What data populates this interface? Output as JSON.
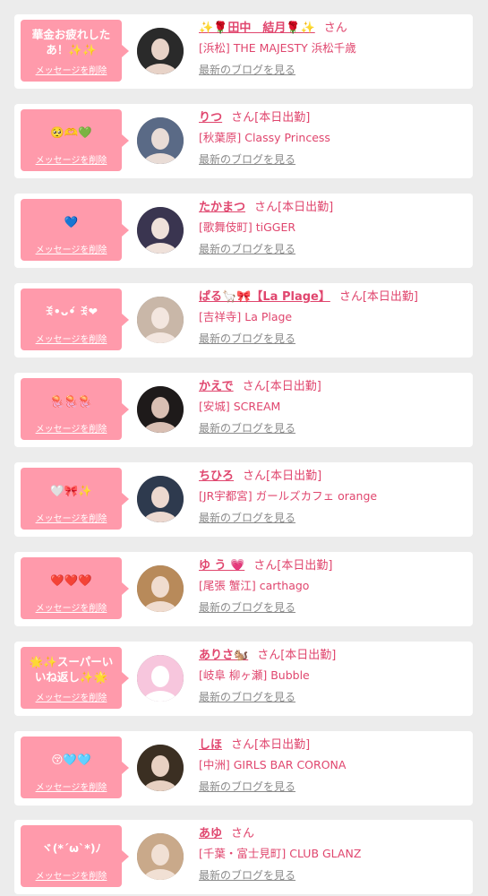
{
  "delete_label": "メッセージを削除",
  "blog_label": "最新のブログを見る",
  "honorific": "さん",
  "items": [
    {
      "message": "華金お疲れした あ！✨✨",
      "name": "✨🌹田中　結月🌹✨",
      "status": "",
      "shop": "[浜松] THE MAJESTY 浜松千歳",
      "avatar_colors": [
        "#2a2a2a",
        "#e8d3c8"
      ]
    },
    {
      "message": "🥺🫶💚",
      "name": "りつ",
      "status": "[本日出勤]",
      "shop": "[秋葉原] Classy Princess",
      "avatar_colors": [
        "#5a6a86",
        "#e9dcd6"
      ]
    },
    {
      "message": "💙",
      "name": "たかまつ",
      "status": "[本日出勤]",
      "shop": "[歌舞伎町] tiGGER",
      "avatar_colors": [
        "#3a3550",
        "#efe1da"
      ]
    },
    {
      "message": "ꉂ•ᴗ•́ ꉂ❤",
      "name": "ぱる🦙🎀【La Plage】",
      "status": "[本日出勤]",
      "shop": "[吉祥寺] La Plage",
      "avatar_colors": [
        "#c9b7a8",
        "#f3e6df"
      ]
    },
    {
      "message": "🪼🪼🪼",
      "name": "かえで",
      "status": "[本日出勤]",
      "shop": "[安城] SCREAM",
      "avatar_colors": [
        "#1e1a1a",
        "#d9bfb3"
      ]
    },
    {
      "message": "🤍🎀✨",
      "name": "ちひろ",
      "status": "[本日出勤]",
      "shop": "[JR宇都宮] ガールズカフェ orange",
      "avatar_colors": [
        "#2e3a4e",
        "#ecd8cf"
      ]
    },
    {
      "message": "❤️❤️❤️",
      "name": "ゆ う 💗",
      "status": "[本日出勤]",
      "shop": "[尾張 蟹江] carthago",
      "avatar_colors": [
        "#b88a5a",
        "#f0dccf"
      ]
    },
    {
      "message": "🌟✨スーパーい いね返し✨🌟",
      "name": "ありさ🐿️",
      "status": "[本日出勤]",
      "shop": "[岐阜 柳ヶ瀬] Bubble",
      "avatar_colors": [
        "#f7c6dd",
        "#ffffff"
      ]
    },
    {
      "message": "😚🩵🩵",
      "name": "しほ",
      "status": "[本日出勤]",
      "shop": "[中洲] GIRLS BAR CORONA",
      "avatar_colors": [
        "#3b2f22",
        "#e8d1c2"
      ]
    },
    {
      "message": "ヾ(*´ω`*)ﾉ",
      "name": "あゆ",
      "status": "",
      "shop": "[千葉・富士見町] CLUB GLANZ",
      "avatar_colors": [
        "#c9a98a",
        "#f1e0d4"
      ]
    }
  ]
}
